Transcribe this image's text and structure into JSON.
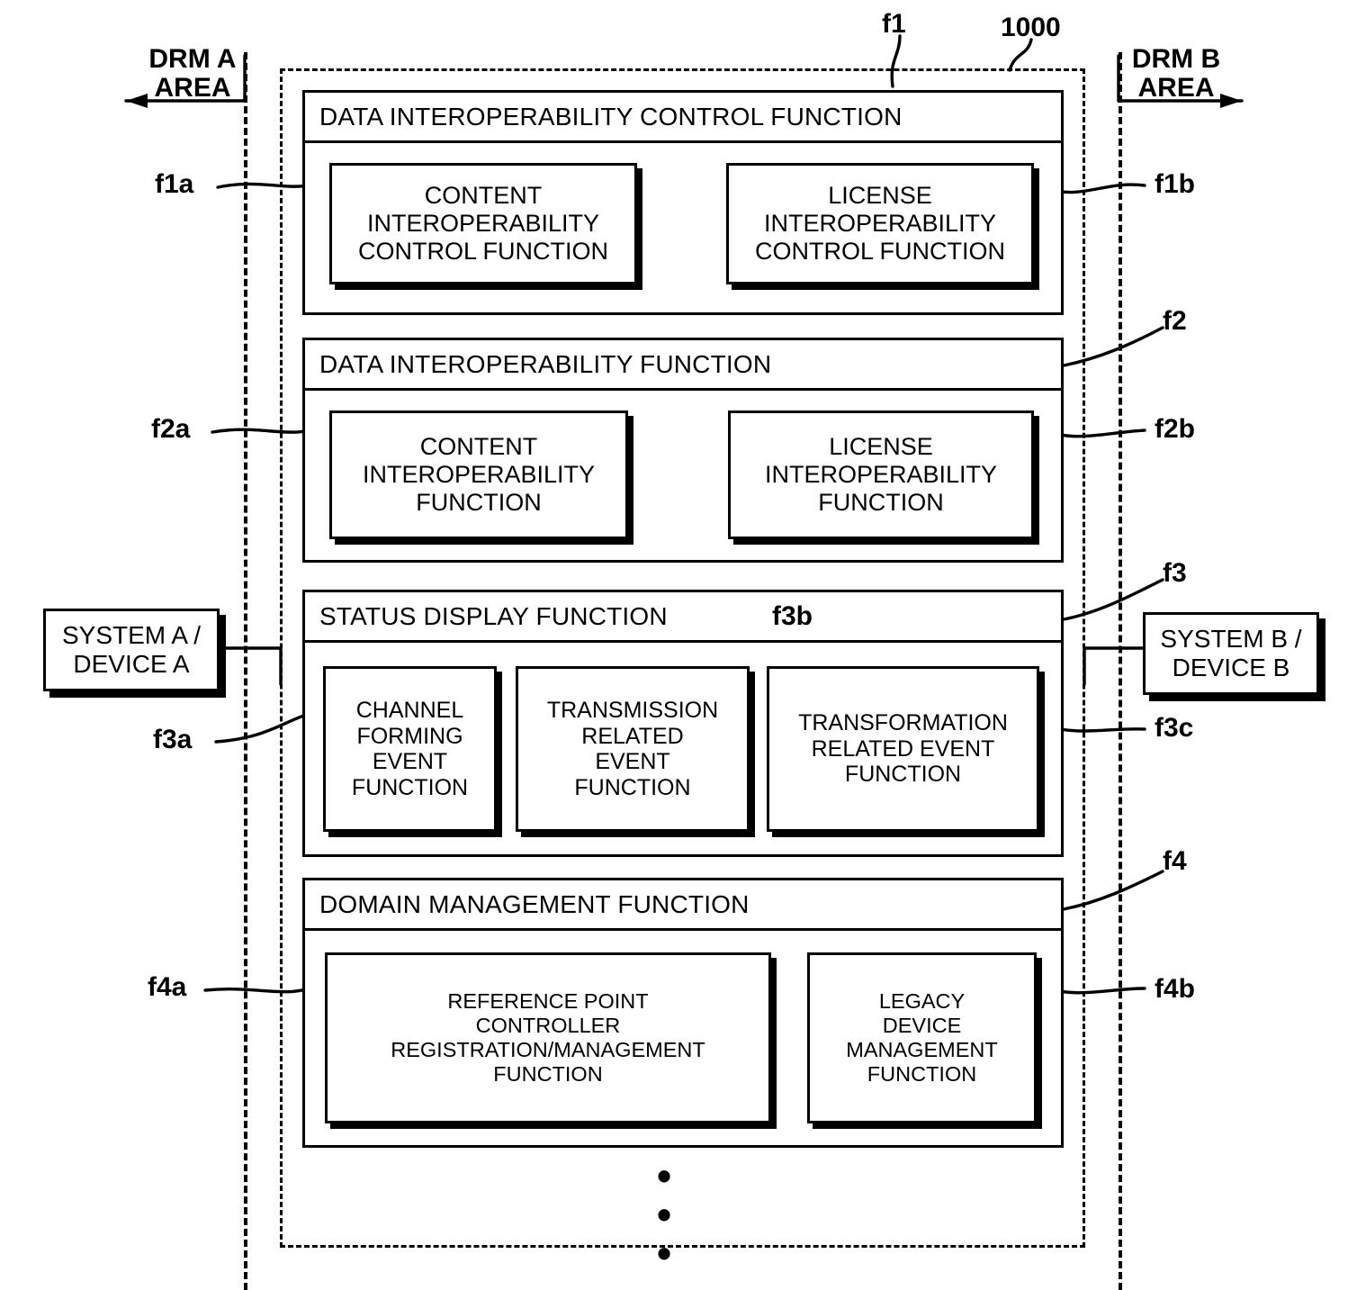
{
  "figure": {
    "system_ref": "1000",
    "area_left": {
      "line1": "DRM A",
      "line2": "AREA"
    },
    "area_right": {
      "line1": "DRM B",
      "line2": "AREA"
    },
    "external_left": {
      "line1": "SYSTEM A /",
      "line2": "DEVICE A"
    },
    "external_right": {
      "line1": "SYSTEM B /",
      "line2": "DEVICE B"
    },
    "vertical_ellipsis": "•\n•\n•"
  },
  "groups": [
    {
      "ref": "f1",
      "title": "DATA INTEROPERABILITY CONTROL FUNCTION",
      "children": [
        {
          "ref": "f1a",
          "lines": [
            "CONTENT",
            "INTEROPERABILITY",
            "CONTROL FUNCTION"
          ]
        },
        {
          "ref": "f1b",
          "lines": [
            "LICENSE",
            "INTEROPERABILITY",
            "CONTROL FUNCTION"
          ]
        }
      ]
    },
    {
      "ref": "f2",
      "title": "DATA INTEROPERABILITY FUNCTION",
      "children": [
        {
          "ref": "f2a",
          "lines": [
            "CONTENT",
            "INTEROPERABILITY",
            "FUNCTION"
          ]
        },
        {
          "ref": "f2b",
          "lines": [
            "LICENSE",
            "INTEROPERABILITY",
            "FUNCTION"
          ]
        }
      ]
    },
    {
      "ref": "f3",
      "title": "STATUS DISPLAY FUNCTION",
      "children": [
        {
          "ref": "f3a",
          "lines": [
            "CHANNEL",
            "FORMING",
            "EVENT",
            "FUNCTION"
          ]
        },
        {
          "ref": "f3b",
          "lines": [
            "TRANSMISSION",
            "RELATED",
            "EVENT",
            "FUNCTION"
          ]
        },
        {
          "ref": "f3c",
          "lines": [
            "TRANSFORMATION",
            "RELATED EVENT",
            "FUNCTION"
          ]
        }
      ]
    },
    {
      "ref": "f4",
      "title": "DOMAIN MANAGEMENT FUNCTION",
      "children": [
        {
          "ref": "f4a",
          "lines": [
            "REFERENCE POINT",
            "CONTROLLER",
            "REGISTRATION/MANAGEMENT",
            "FUNCTION"
          ]
        },
        {
          "ref": "f4b",
          "lines": [
            "LEGACY",
            "DEVICE",
            "MANAGEMENT",
            "FUNCTION"
          ]
        }
      ]
    }
  ]
}
